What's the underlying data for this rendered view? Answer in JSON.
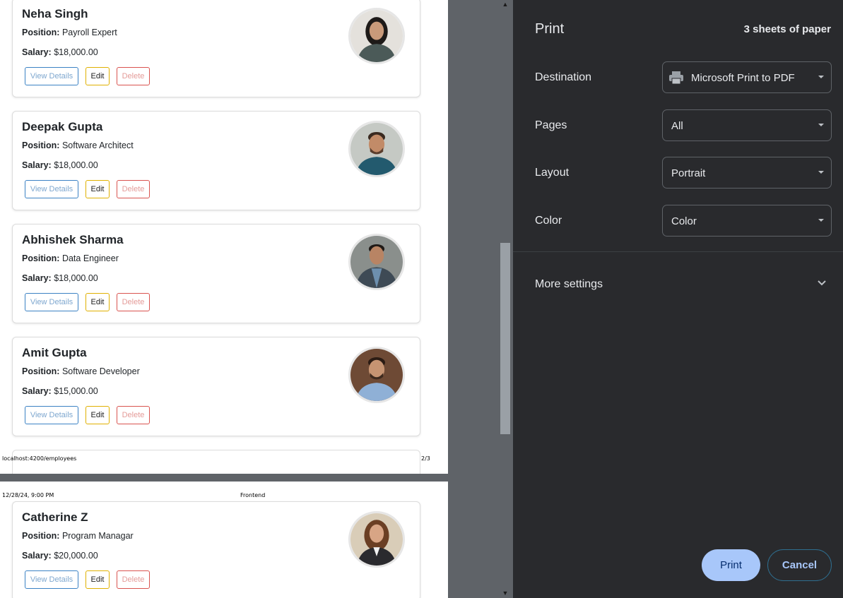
{
  "pages": {
    "page2": {
      "cards": [
        {
          "name": "Neha Singh",
          "position_label": "Position:",
          "position": "Payroll Expert",
          "salary_label": "Salary:",
          "salary": "$18,000.00",
          "buttons": {
            "view": "View Details",
            "edit": "Edit",
            "delete": "Delete"
          }
        },
        {
          "name": "Deepak Gupta",
          "position_label": "Position:",
          "position": "Software Architect",
          "salary_label": "Salary:",
          "salary": "$18,000.00",
          "buttons": {
            "view": "View Details",
            "edit": "Edit",
            "delete": "Delete"
          }
        },
        {
          "name": "Abhishek Sharma",
          "position_label": "Position:",
          "position": "Data Engineer",
          "salary_label": "Salary:",
          "salary": "$18,000.00",
          "buttons": {
            "view": "View Details",
            "edit": "Edit",
            "delete": "Delete"
          }
        },
        {
          "name": "Amit Gupta",
          "position_label": "Position:",
          "position": "Software Developer",
          "salary_label": "Salary:",
          "salary": "$15,000.00",
          "buttons": {
            "view": "View Details",
            "edit": "Edit",
            "delete": "Delete"
          }
        }
      ],
      "footer_url": "localhost:4200/employees",
      "footer_page": "2/3"
    },
    "page3": {
      "header_date": "12/28/24, 9:00 PM",
      "header_title": "Frontend",
      "cards": [
        {
          "name": "Catherine Z",
          "position_label": "Position:",
          "position": "Program Managar",
          "salary_label": "Salary:",
          "salary": "$20,000.00",
          "buttons": {
            "view": "View Details",
            "edit": "Edit",
            "delete": "Delete"
          }
        }
      ]
    }
  },
  "print_panel": {
    "title": "Print",
    "sheet_count": "3 sheets of paper",
    "destination": {
      "label": "Destination",
      "value": "Microsoft Print to PDF",
      "icon": "printer-icon"
    },
    "pages": {
      "label": "Pages",
      "value": "All"
    },
    "layout": {
      "label": "Layout",
      "value": "Portrait"
    },
    "color": {
      "label": "Color",
      "value": "Color"
    },
    "more_settings": "More settings",
    "print_button": "Print",
    "cancel_button": "Cancel"
  },
  "colors": {
    "panel_bg": "#292a2d",
    "preview_bg": "#5f6368",
    "print_button_bg": "#a8c7fa",
    "view_button_border": "#3b82c4",
    "edit_button_border": "#e0b000",
    "delete_button_border": "#d9534f"
  }
}
